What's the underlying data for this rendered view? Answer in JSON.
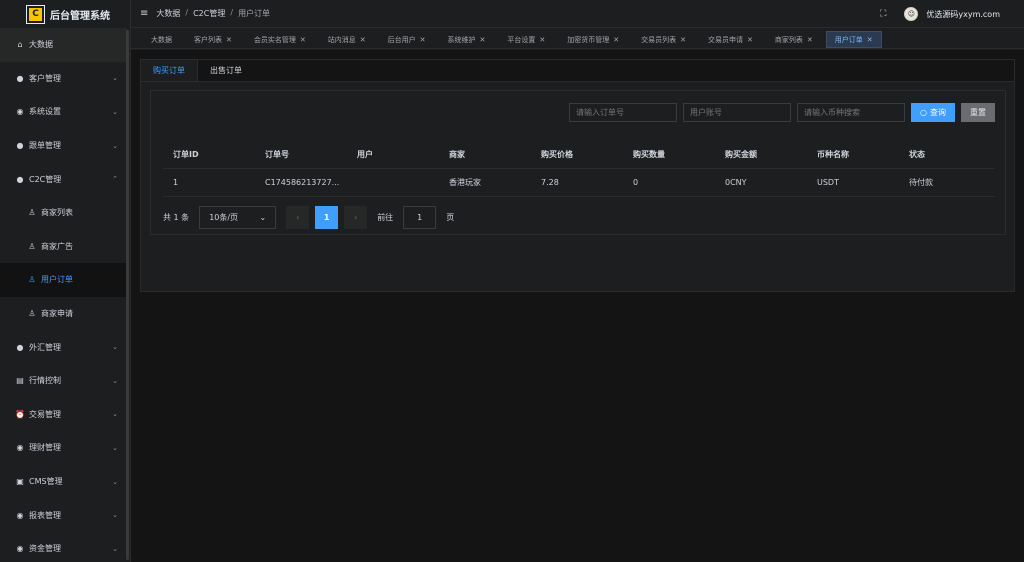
{
  "app": {
    "title": "后台管理系统",
    "logo_letter": "C"
  },
  "header": {
    "breadcrumb": [
      "大数据",
      "C2C管理",
      "用户订单"
    ],
    "username": "优选源码yxym.com"
  },
  "sidebar": {
    "items": [
      {
        "label": "大数据",
        "icon": "home-icon",
        "glyph": "⌂"
      },
      {
        "label": "客户管理",
        "icon": "user-icon",
        "glyph": "●"
      },
      {
        "label": "系统设置",
        "icon": "shield-icon",
        "glyph": "◉"
      },
      {
        "label": "跟单管理",
        "icon": "user-icon",
        "glyph": "●"
      },
      {
        "label": "C2C管理",
        "icon": "user-icon",
        "glyph": "●"
      },
      {
        "label": "商家列表",
        "icon": "thumb-icon",
        "glyph": "♙"
      },
      {
        "label": "商家广告",
        "icon": "thumb-icon",
        "glyph": "♙"
      },
      {
        "label": "用户订单",
        "icon": "thumb-icon",
        "glyph": "♙"
      },
      {
        "label": "商家申请",
        "icon": "thumb-icon",
        "glyph": "♙"
      },
      {
        "label": "外汇管理",
        "icon": "user-icon",
        "glyph": "●"
      },
      {
        "label": "行情控制",
        "icon": "chart-icon",
        "glyph": "▤"
      },
      {
        "label": "交易管理",
        "icon": "alarm-icon",
        "glyph": "⏰"
      },
      {
        "label": "理财管理",
        "icon": "shield-icon",
        "glyph": "◉"
      },
      {
        "label": "CMS管理",
        "icon": "cms-icon",
        "glyph": "▣"
      },
      {
        "label": "报表管理",
        "icon": "shield-icon",
        "glyph": "◉"
      },
      {
        "label": "资金管理",
        "icon": "shield-icon",
        "glyph": "◉"
      }
    ]
  },
  "tabs": [
    {
      "label": "大数据"
    },
    {
      "label": "客户列表"
    },
    {
      "label": "会员实名管理"
    },
    {
      "label": "站内消息"
    },
    {
      "label": "后台用户"
    },
    {
      "label": "系统维护"
    },
    {
      "label": "平台设置"
    },
    {
      "label": "加密货币管理"
    },
    {
      "label": "交易员列表"
    },
    {
      "label": "交易员申请"
    },
    {
      "label": "商家列表"
    },
    {
      "label": "用户订单"
    }
  ],
  "subtabs": [
    "购买订单",
    "出售订单"
  ],
  "search": {
    "order_no_placeholder": "请输入订单号",
    "account_placeholder": "用户账号",
    "coin_placeholder": "请输入币种搜索",
    "query_label": "查询",
    "reset_label": "重置"
  },
  "table": {
    "headers": [
      "订单ID",
      "订单号",
      "用户",
      "商家",
      "购买价格",
      "购买数量",
      "购买金额",
      "币种名称",
      "状态"
    ],
    "rows": [
      [
        "1",
        "C174586213727...",
        "",
        "香港玩家",
        "7.28",
        "0",
        "0CNY",
        "USDT",
        "待付款"
      ]
    ]
  },
  "pagination": {
    "total_text": "共 1 条",
    "page_size": "10条/页",
    "current_page": "1",
    "goto_label": "前往",
    "goto_value": "1",
    "page_unit": "页"
  },
  "colors": {
    "accent": "#409eff",
    "bg": "#1d1e1f",
    "main_bg": "#141414"
  }
}
